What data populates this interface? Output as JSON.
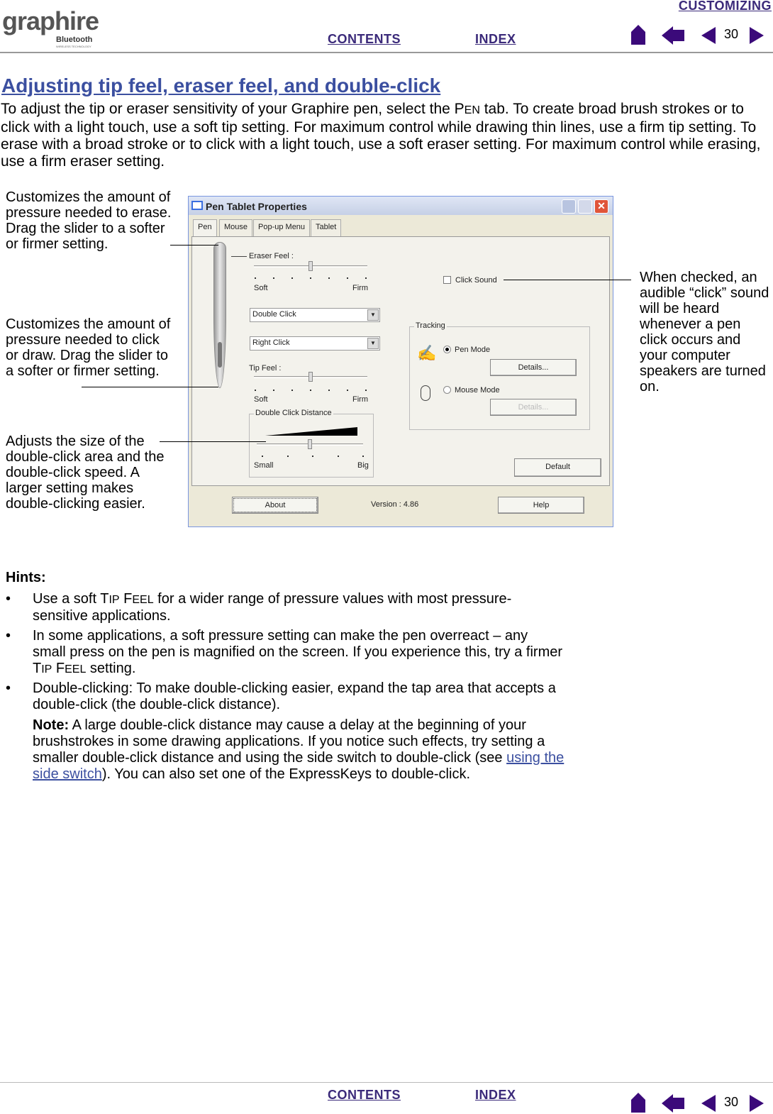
{
  "header": {
    "logo": {
      "word": "graphire",
      "sub": "Bluetooth",
      "tag": "WIRELESS TECHNOLOGY"
    },
    "section_link": "CUSTOMIZING",
    "contents_link": "CONTENTS",
    "index_link": "INDEX",
    "page_number": "30",
    "nav_color": "#3b0a7a"
  },
  "page": {
    "title": "Adjusting tip feel, eraser feel, and double-click",
    "intro_a": "To adjust the tip or eraser sensitivity of your Graphire pen, select the P",
    "intro_sc": "EN",
    "intro_b": " tab.  To create broad brush strokes or to click with a light touch, use a soft tip setting.  For maximum control while drawing thin lines, use a firm tip setting.  To erase with a broad stroke or to click with a light touch, use a soft eraser setting.  For maximum control while erasing, use a firm eraser setting."
  },
  "callouts": {
    "eraser": "Customizes the amount of pressure needed to erase.  Drag the slider to a softer or firmer setting.",
    "tip": "Customizes the amount of pressure needed to click or draw.  Drag the slider to a softer or firmer setting.",
    "distance": "Adjusts the size of the double-click area and the double-click speed. A larger setting makes double-clicking easier.",
    "sound": "When checked, an audible “click” sound will be heard whenever a pen click occurs and your computer speakers are turned on."
  },
  "dialog": {
    "title": "Pen Tablet Properties",
    "tabs": [
      "Pen",
      "Mouse",
      "Pop-up Menu",
      "Tablet"
    ],
    "eraser_feel": {
      "label": "Eraser Feel :",
      "soft": "Soft",
      "firm": "Firm",
      "value_fraction": 0.5
    },
    "upper_switch": "Double Click",
    "lower_switch": "Right Click",
    "tip_feel": {
      "label": "Tip Feel :",
      "soft": "Soft",
      "firm": "Firm",
      "value_fraction": 0.5
    },
    "double_click_distance": {
      "label": "Double Click Distance",
      "small": "Small",
      "big": "Big",
      "value_fraction": 0.5
    },
    "click_sound": {
      "label": "Click Sound",
      "checked": false
    },
    "tracking": {
      "label": "Tracking",
      "pen_mode": "Pen Mode",
      "mouse_mode": "Mouse Mode",
      "selected": "Pen Mode",
      "details": "Details...",
      "details_disabled": "Details..."
    },
    "default_btn": "Default",
    "about_btn": "About",
    "version": "Version : 4.86",
    "help_btn": "Help"
  },
  "hints": {
    "title": "Hints:",
    "h1a": "Use a soft T",
    "h1s1": "IP",
    "h1m": " F",
    "h1s2": "EEL",
    "h1b": " for a wider range of pressure values with most pressure-sensitive applications.",
    "h2a": "In some applications, a soft pressure setting can make the pen overreact – any small press on the pen is magnified on the screen.  If you experience this, try a firmer T",
    "h2s1": "IP",
    "h2m": " F",
    "h2s2": "EEL",
    "h2b": " setting.",
    "h3": "Double-clicking: To make double-clicking easier, expand the tap area that accepts a double-click (the double-click distance).",
    "note_label": "Note:",
    "note_a": " A large double-click distance may cause a delay at the beginning of your brushstrokes in some drawing applications.  If you notice such effects, try setting a smaller double-click distance and using the side switch to double-click (see ",
    "note_link": "using the side switch",
    "note_b": ").  You can also set one of the ExpressKeys to double-click."
  }
}
